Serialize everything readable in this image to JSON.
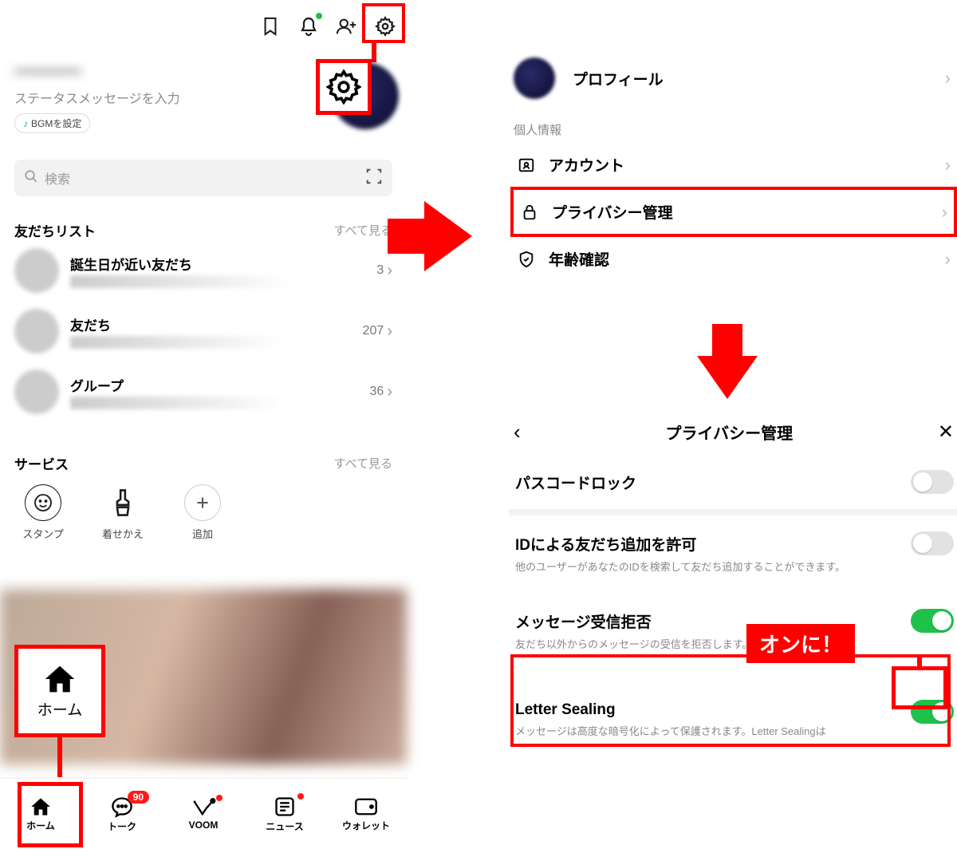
{
  "left": {
    "profile_name": "———",
    "status_placeholder": "ステータスメッセージを入力",
    "bgm_label": "BGMを設定",
    "search_placeholder": "検索",
    "friends": {
      "heading": "友だちリスト",
      "see_all": "すべて見る",
      "items": [
        {
          "name": "誕生日が近い友だち",
          "count": "3"
        },
        {
          "name": "友だち",
          "count": "207"
        },
        {
          "name": "グループ",
          "count": "36"
        }
      ]
    },
    "services": {
      "heading": "サービス",
      "see_all": "すべて見る",
      "items": [
        {
          "label": "スタンプ"
        },
        {
          "label": "着せかえ"
        },
        {
          "label": "追加"
        }
      ]
    },
    "home_callout_label": "ホーム",
    "tabs": [
      {
        "label": "ホーム",
        "badge": null,
        "dot": false
      },
      {
        "label": "トーク",
        "badge": "90",
        "dot": false
      },
      {
        "label": "VOOM",
        "badge": null,
        "dot": true
      },
      {
        "label": "ニュース",
        "badge": null,
        "dot": true
      },
      {
        "label": "ウォレット",
        "badge": null,
        "dot": false
      }
    ]
  },
  "right": {
    "profile_label": "プロフィール",
    "section_personal": "個人情報",
    "rows": {
      "account": "アカウント",
      "privacy": "プライバシー管理",
      "age": "年齢確認"
    },
    "privacy_panel": {
      "title": "プライバシー管理",
      "passcode": "パスコードロック",
      "id_allow_title": "IDによる友だち追加を許可",
      "id_allow_desc": "他のユーザーがあなたのIDを検索して友だち追加することができます。",
      "msg_reject_title": "メッセージ受信拒否",
      "msg_reject_desc": "友だち以外からのメッセージの受信を拒否します。",
      "letter_title": "Letter Sealing",
      "letter_desc": "メッセージは高度な暗号化によって保護されます。Letter Sealingは"
    },
    "on_callout": "オンに！"
  }
}
